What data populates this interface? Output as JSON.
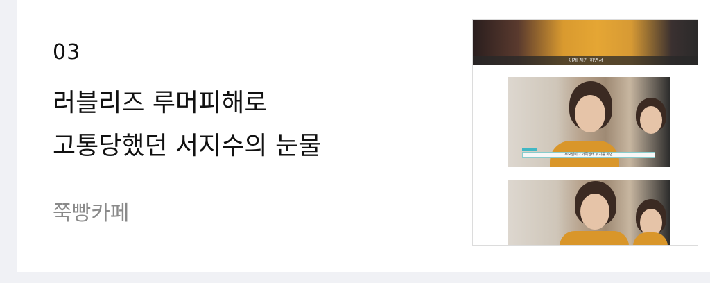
{
  "article": {
    "rank": "03",
    "title_line1": "러블리즈 루머피해로",
    "title_line2": "고통당했던 서지수의 눈물",
    "source": "쭉빵카페"
  },
  "thumbnail": {
    "top_caption": "이제 제가 하면서",
    "subtitle": "부모님이나 가족한테 뭐지를 하면"
  }
}
